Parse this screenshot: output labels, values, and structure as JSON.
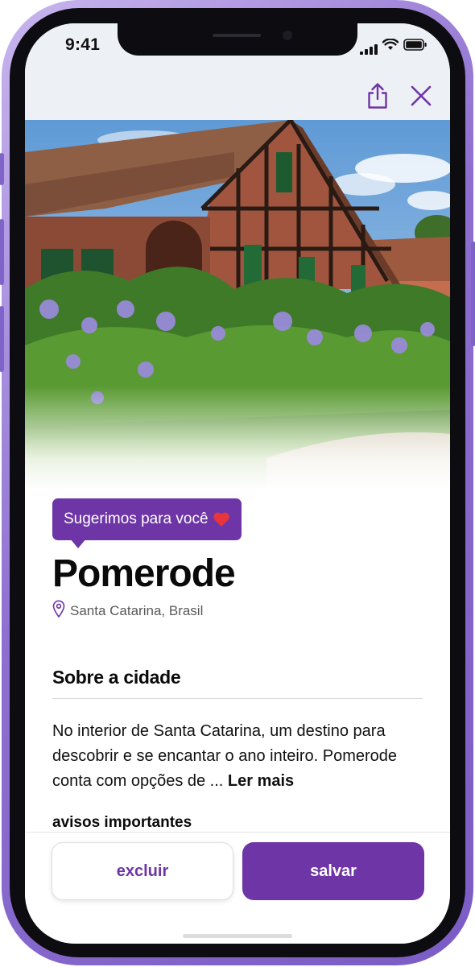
{
  "status_bar": {
    "time": "9:41"
  },
  "top_actions": {
    "share_icon": "share-icon",
    "close_icon": "close-icon",
    "accent_color": "#6e35a6"
  },
  "hero": {
    "image": "half-timbered-brick-house-with-flowers"
  },
  "badge": {
    "label": "Sugerimos para você",
    "icon": "heart-icon",
    "color": "#6e35a6"
  },
  "destination": {
    "name": "Pomerode",
    "location": "Santa Catarina, Brasil",
    "location_icon": "pin-icon"
  },
  "about": {
    "title": "Sobre a cidade",
    "text": "No interior de Santa Catarina, um destino para descobrir e se encantar o ano inteiro. Pomerode conta com opções de ... ",
    "read_more": "Ler mais"
  },
  "notices": {
    "title": "avisos importantes"
  },
  "actions": {
    "delete_label": "excluir",
    "save_label": "salvar"
  }
}
